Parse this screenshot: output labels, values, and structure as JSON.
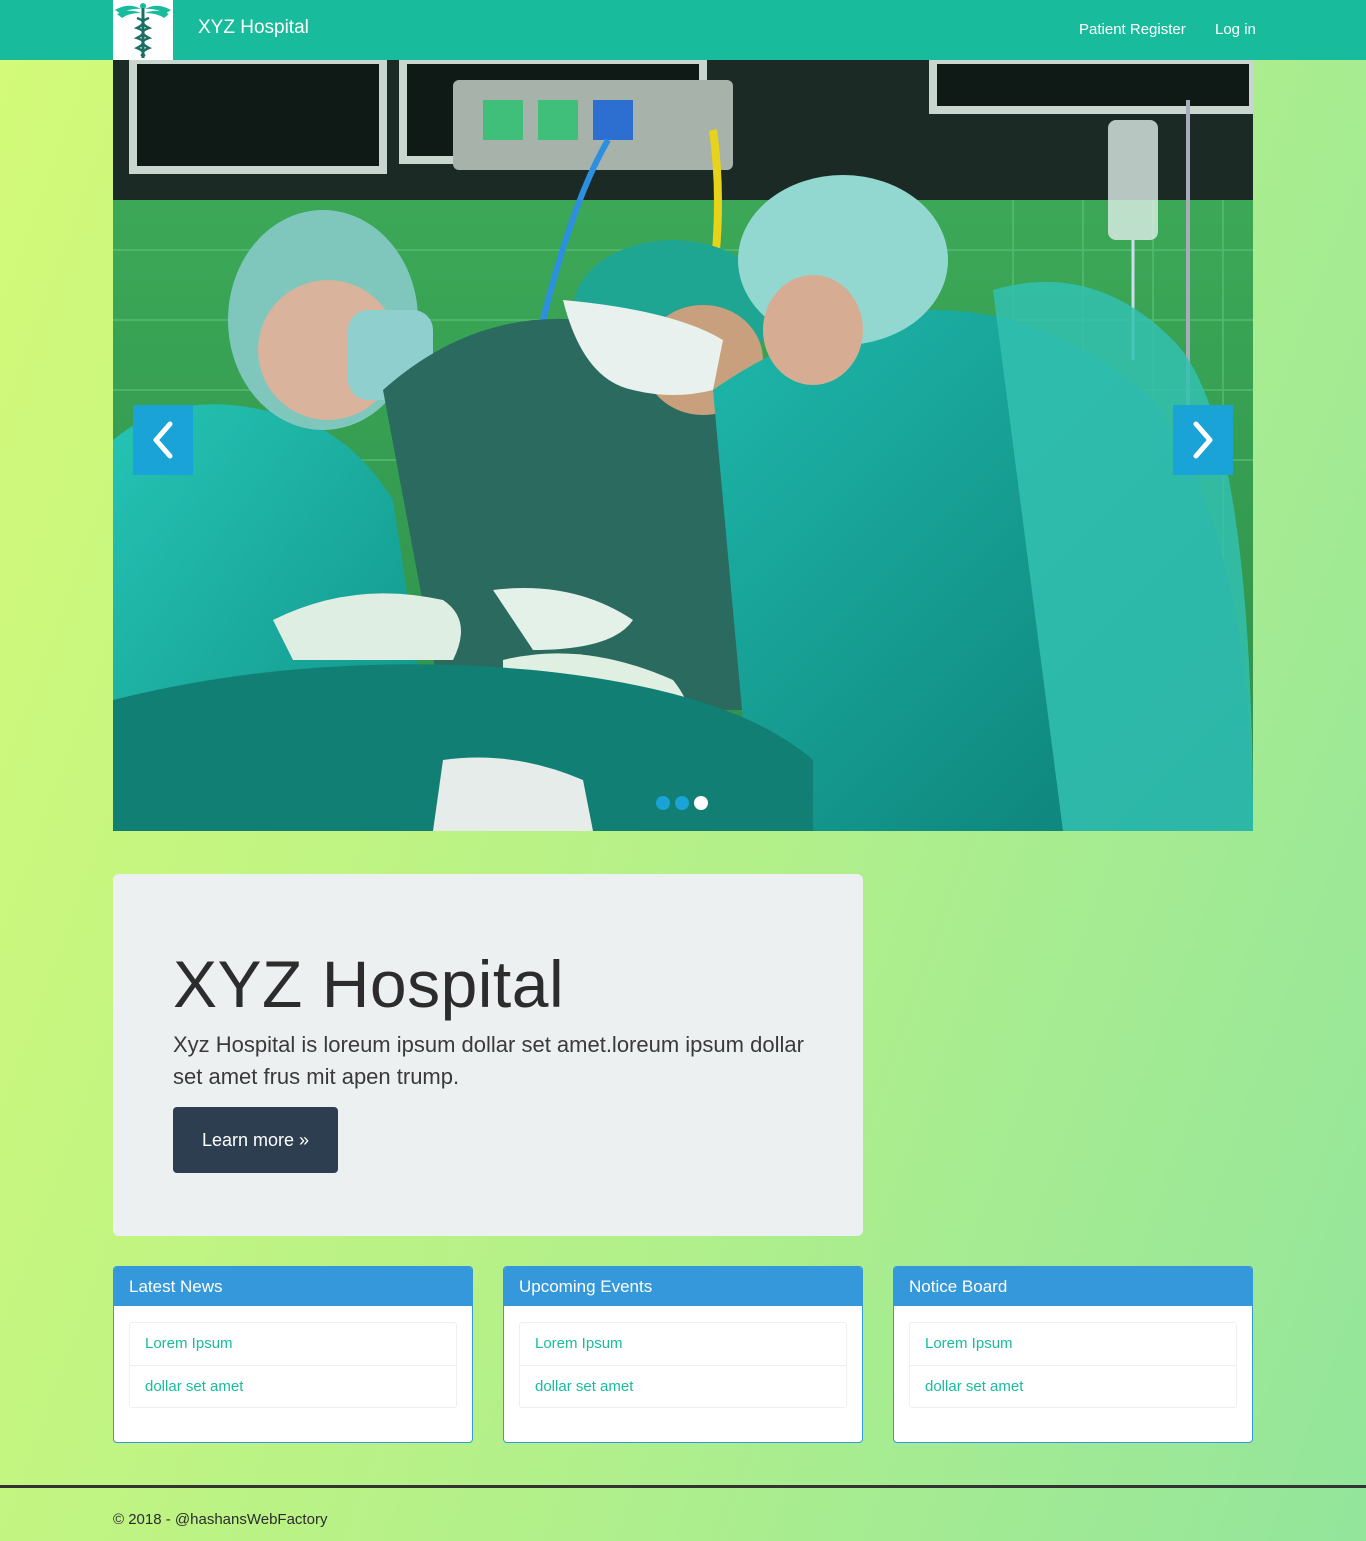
{
  "navbar": {
    "brand": "XYZ Hospital",
    "logo_icon": "caduceus-icon",
    "links": {
      "register": "Patient Register",
      "login": "Log in"
    },
    "color": "#18bc9c"
  },
  "carousel": {
    "prev_icon": "chevron-left-icon",
    "next_icon": "chevron-right-icon",
    "slide_count": 3,
    "active_index": 2,
    "control_color": "#1aa3d6"
  },
  "jumbotron": {
    "title": "XYZ Hospital",
    "text": "Xyz Hospital is loreum ipsum dollar set amet.loreum ipsum dollar set amet frus mit apen trump.",
    "button": "Learn more »"
  },
  "panels": [
    {
      "title": "Latest News",
      "items": [
        "Lorem Ipsum",
        "dollar set amet"
      ]
    },
    {
      "title": "Upcoming Events",
      "items": [
        "Lorem Ipsum",
        "dollar set amet"
      ]
    },
    {
      "title": "Notice Board",
      "items": [
        "Lorem Ipsum",
        "dollar set amet"
      ]
    }
  ],
  "footer": {
    "text": "© 2018 - @hashansWebFactory"
  },
  "colors": {
    "panel_heading": "#3498db",
    "button": "#2c3e50",
    "link": "#18bc9c"
  }
}
